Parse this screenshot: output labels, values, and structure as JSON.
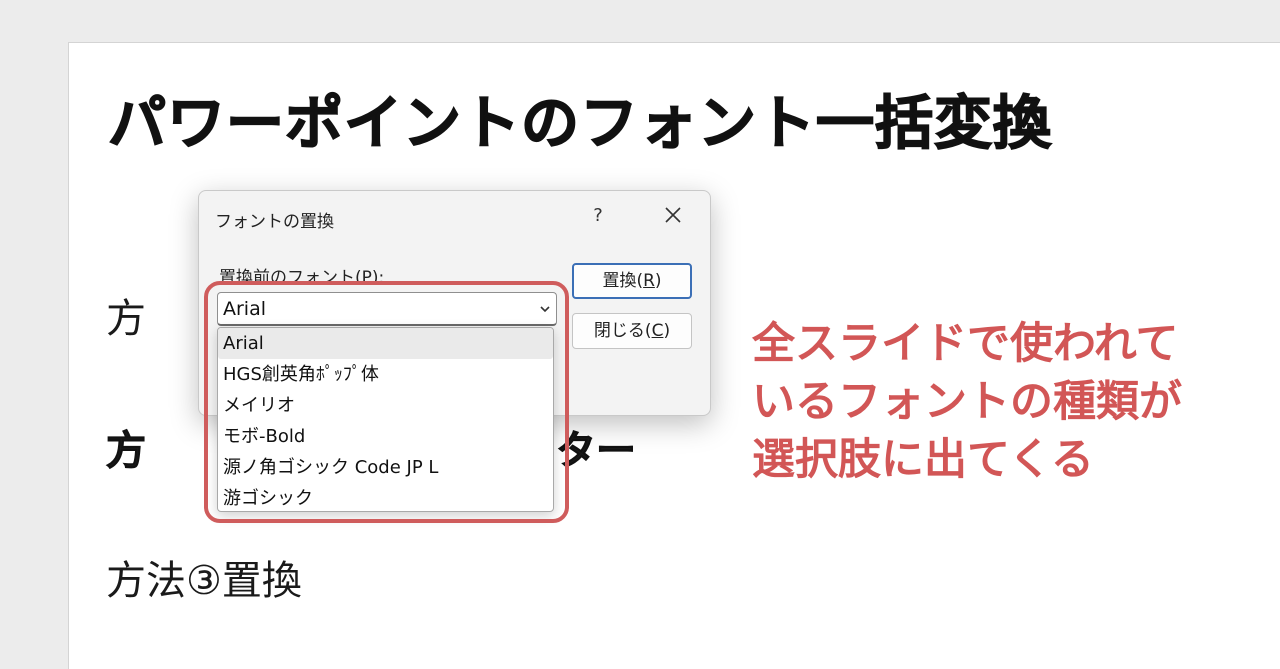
{
  "slide": {
    "title": "パワーポイントのフォント一括変換",
    "line1_partial": "方",
    "line2_partial_left": "方",
    "line2_partial_right": "スター",
    "line3": "方法③置換"
  },
  "dialog": {
    "title": "フォントの置換",
    "help": "?",
    "label": "置換前のフォント(P):",
    "select_value": "Arial",
    "replace_button": {
      "text": "置換(",
      "key": "R",
      "end": ")"
    },
    "close_button": {
      "text": "閉じる(",
      "key": "C",
      "end": ")"
    }
  },
  "dropdown": {
    "options": [
      "Arial",
      "HGS創英角ﾎﾟｯﾌﾟ体",
      "メイリオ",
      "モボ-Bold",
      "源ノ角ゴシック Code JP L",
      "游ゴシック"
    ],
    "selected_index": 0
  },
  "annotation": {
    "lines": [
      "全スライドで使われて",
      "いるフォントの種類が",
      "選択肢に出てくる"
    ],
    "color": "#d25656"
  }
}
